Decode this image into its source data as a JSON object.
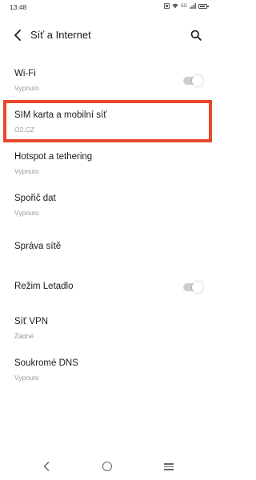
{
  "status_bar": {
    "time": "13:48",
    "network": "5G"
  },
  "header": {
    "title": "Síť a Internet",
    "back_icon": "chevron-left-icon",
    "search_icon": "search-icon"
  },
  "items": [
    {
      "title": "Wi-Fi",
      "subtitle": "Vypnuto",
      "toggle": "off"
    },
    {
      "title": "SIM karta a mobilní síť",
      "subtitle": "O2.CZ",
      "highlighted": true
    },
    {
      "title": "Hotspot a tethering",
      "subtitle": "Vypnuto"
    },
    {
      "title": "Spořič dat",
      "subtitle": "Vypnuto"
    },
    {
      "title": "Správa sítě"
    },
    {
      "title": "Režim Letadlo",
      "toggle": "off"
    },
    {
      "title": "Síť VPN",
      "subtitle": "Žádné"
    },
    {
      "title": "Soukromé DNS",
      "subtitle": "Vypnuto"
    }
  ],
  "colors": {
    "highlight": "#e5482a",
    "toggle_off": "#cfcfcf",
    "subtitle": "#9a9a9a"
  },
  "nav_bar": {
    "icons": [
      "nav-back-icon",
      "nav-home-icon",
      "nav-menu-icon"
    ]
  }
}
